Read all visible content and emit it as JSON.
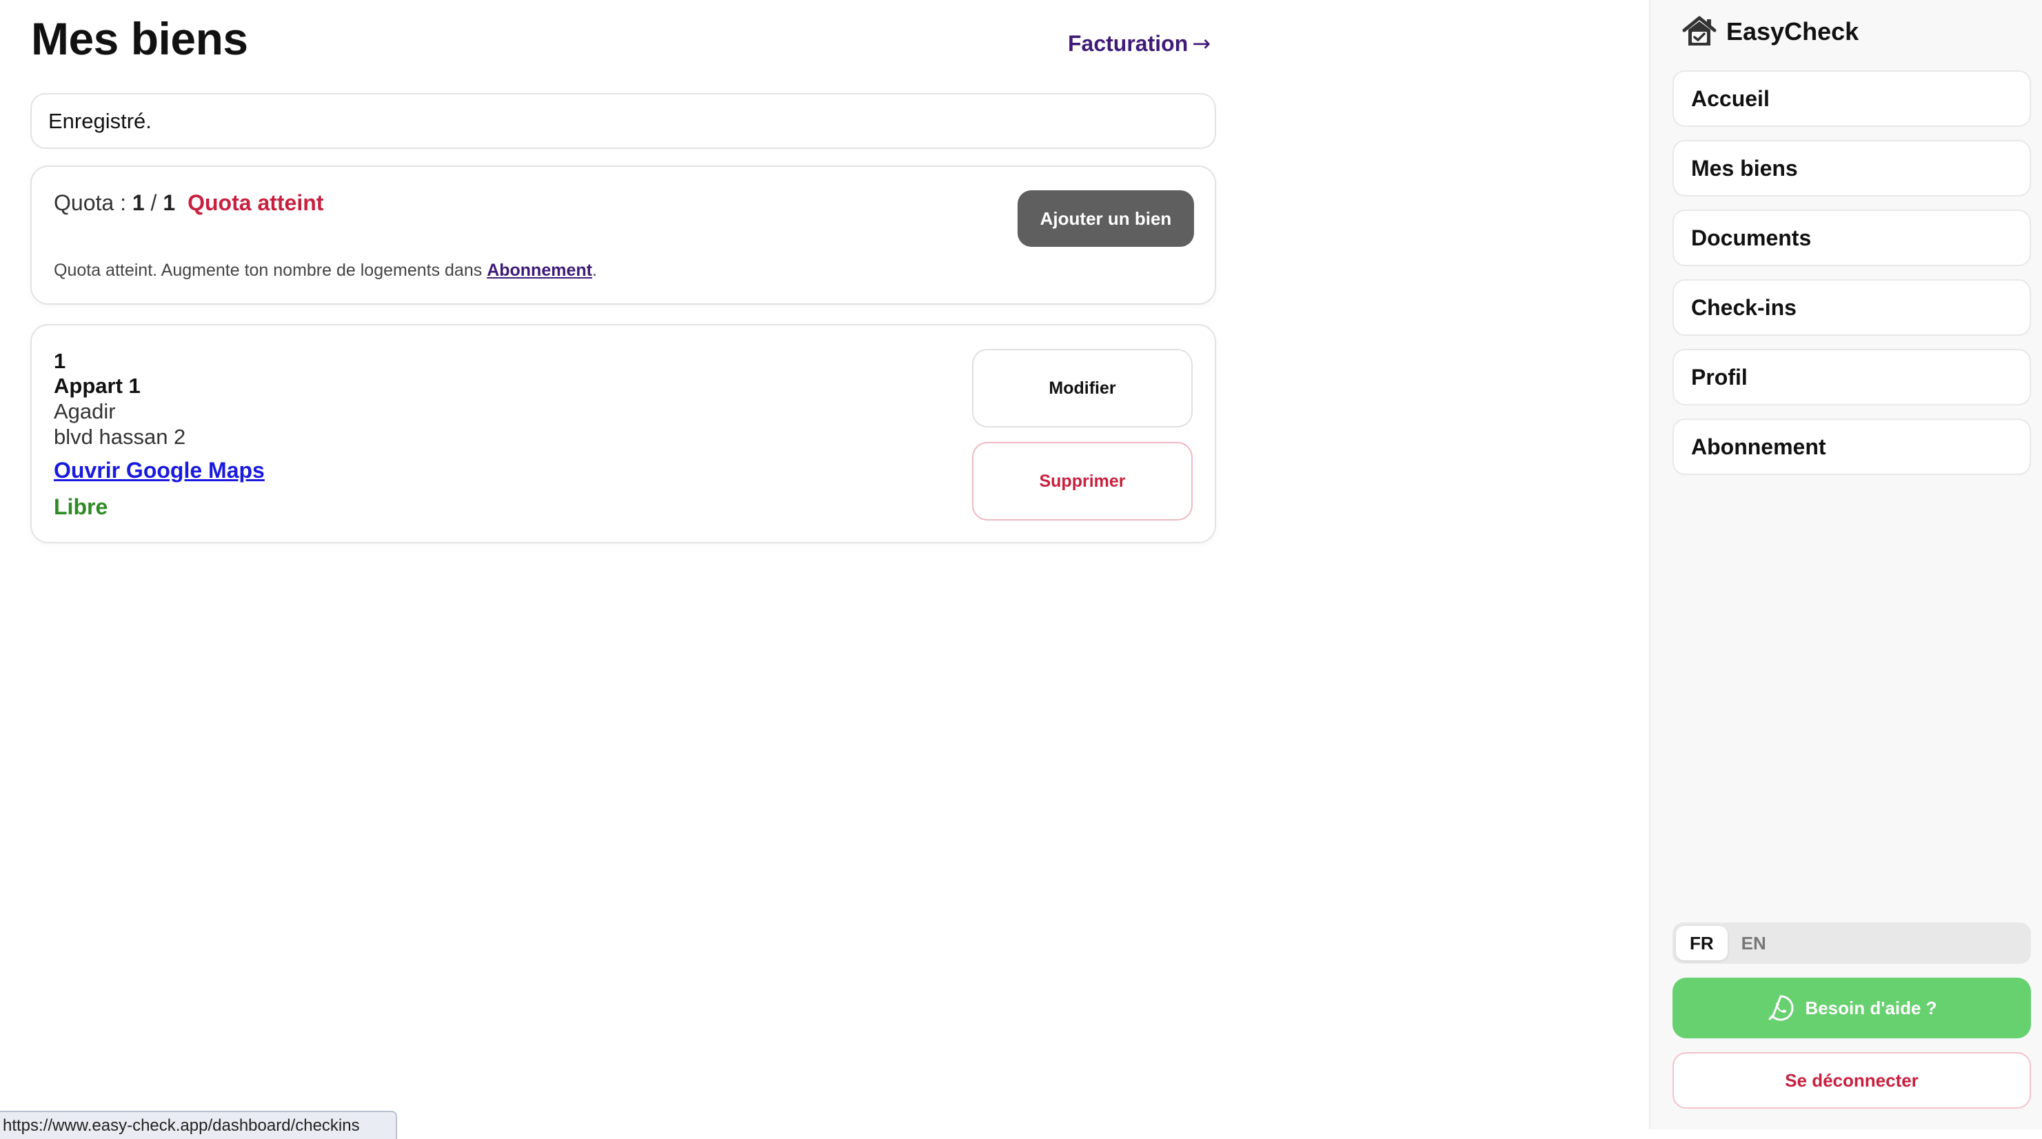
{
  "page": {
    "title": "Mes biens",
    "billing_link": "Facturation",
    "billing_arrow": "→",
    "notice": "Enregistré."
  },
  "quota": {
    "label": "Quota : ",
    "used": "1",
    "separator": " / ",
    "limit": "1",
    "status": "Quota atteint",
    "add_button": "Ajouter un bien",
    "hint_text": "Quota atteint. Augmente ton nombre de logements dans ",
    "hint_link": "Abonnement",
    "hint_end": "."
  },
  "properties": [
    {
      "number": "1",
      "name": "Appart 1",
      "city": "Agadir",
      "address": "blvd hassan 2",
      "maps_link": "Ouvrir Google Maps",
      "status": "Libre",
      "edit_button": "Modifier",
      "delete_button": "Supprimer"
    }
  ],
  "status_bar": {
    "url": "https://www.easy-check.app/dashboard/checkins"
  },
  "sidebar": {
    "brand": "EasyCheck",
    "brand_icon": "house-check-icon",
    "items": [
      {
        "label": "Accueil"
      },
      {
        "label": "Mes biens"
      },
      {
        "label": "Documents"
      },
      {
        "label": "Check-ins"
      },
      {
        "label": "Profil"
      },
      {
        "label": "Abonnement"
      }
    ],
    "languages": [
      {
        "code": "FR",
        "active": true
      },
      {
        "code": "EN",
        "active": false
      }
    ],
    "help_button": "Besoin d'aide ?",
    "help_icon": "whatsapp-icon",
    "logout_button": "Se déconnecter"
  },
  "colors": {
    "accent": "#3f1b78",
    "danger": "#c8203f",
    "success": "#2e8b24",
    "whatsapp": "#67d06f",
    "primary_button": "#5f5f5f"
  }
}
